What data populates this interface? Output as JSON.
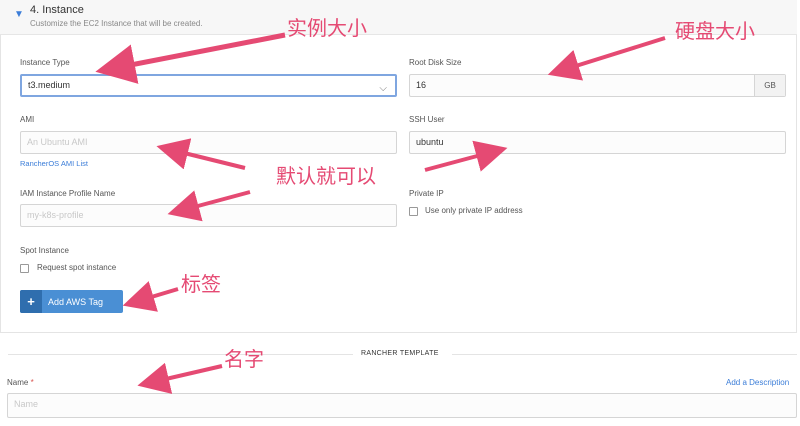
{
  "section": {
    "title": "4. Instance",
    "description": "Customize the EC2 Instance that will be created."
  },
  "form": {
    "instance_type": {
      "label": "Instance Type",
      "value": "t3.medium"
    },
    "root_disk": {
      "label": "Root Disk Size",
      "value": "16",
      "unit": "GB"
    },
    "ami": {
      "label": "AMI",
      "placeholder": "An Ubuntu AMI",
      "link": "RancherOS AMI List"
    },
    "ssh_user": {
      "label": "SSH User",
      "value": "ubuntu"
    },
    "iam_profile": {
      "label": "IAM Instance Profile Name",
      "placeholder": "my-k8s-profile"
    },
    "private_ip": {
      "label": "Private IP",
      "checkbox_label": "Use only private IP address"
    },
    "spot_instance": {
      "label": "Spot Instance",
      "checkbox_label": "Request spot instance"
    },
    "add_tag_button": {
      "icon": "+",
      "label": "Add AWS Tag"
    }
  },
  "rancher_template": {
    "title": "RANCHER TEMPLATE",
    "name_label": "Name",
    "required_mark": "*",
    "name_placeholder": "Name",
    "add_description_link": "Add a Description"
  },
  "annotations": {
    "instance_size": "实例大小",
    "disk_size": "硬盘大小",
    "default_ok": "默认就可以",
    "tags": "标签",
    "name": "名字"
  },
  "colors": {
    "accent": "#3b7dd8",
    "button": "#4a8fd4",
    "annotation": "#e54a73",
    "required": "#d9534f"
  }
}
